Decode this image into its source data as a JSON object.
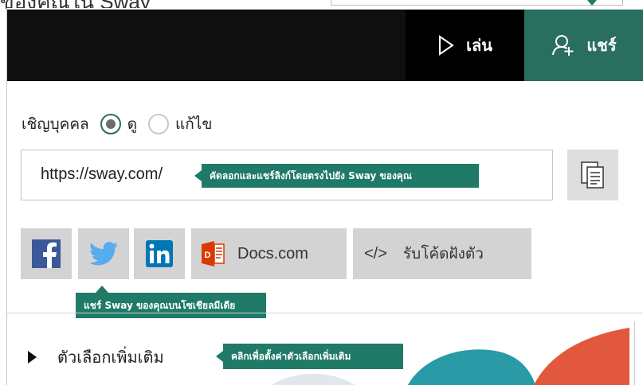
{
  "page": {
    "caption_partial": "ของคุณใน Sway"
  },
  "header": {
    "play_label": "เล่น",
    "share_label": "แชร์"
  },
  "invite": {
    "label": "เชิญบุคคล",
    "options": [
      {
        "label": "ดู",
        "selected": true
      },
      {
        "label": "แก้ไข",
        "selected": false
      }
    ]
  },
  "link": {
    "url": "https://sway.com/",
    "copy_tooltip": "คัดลอกและแชร์ลิงก์โดยตรงไปยัง Sway ของคุณ",
    "copy_icon": "copy-icon"
  },
  "social": {
    "facebook_icon": "facebook-icon",
    "twitter_icon": "twitter-icon",
    "linkedin_icon": "linkedin-icon",
    "docs_label": "Docs.com",
    "embed_symbol": "</>",
    "embed_label": "รับโค้ดฝังตัว",
    "tooltip": "แชร์ Sway ของคุณบนโซเชียลมีเดีย"
  },
  "more_options": {
    "label": "ตัวเลือกเพิ่มเติม",
    "tooltip": "คลิกเพื่อตั้งค่าตัวเลือกเพิ่มเติม"
  },
  "colors": {
    "accent": "#2a6e5f",
    "tooltip": "#1f7a68",
    "header": "#0f0f0f",
    "facebook": "#3b5998",
    "twitter": "#55acee",
    "linkedin": "#0077b5",
    "office": "#d83b01"
  }
}
